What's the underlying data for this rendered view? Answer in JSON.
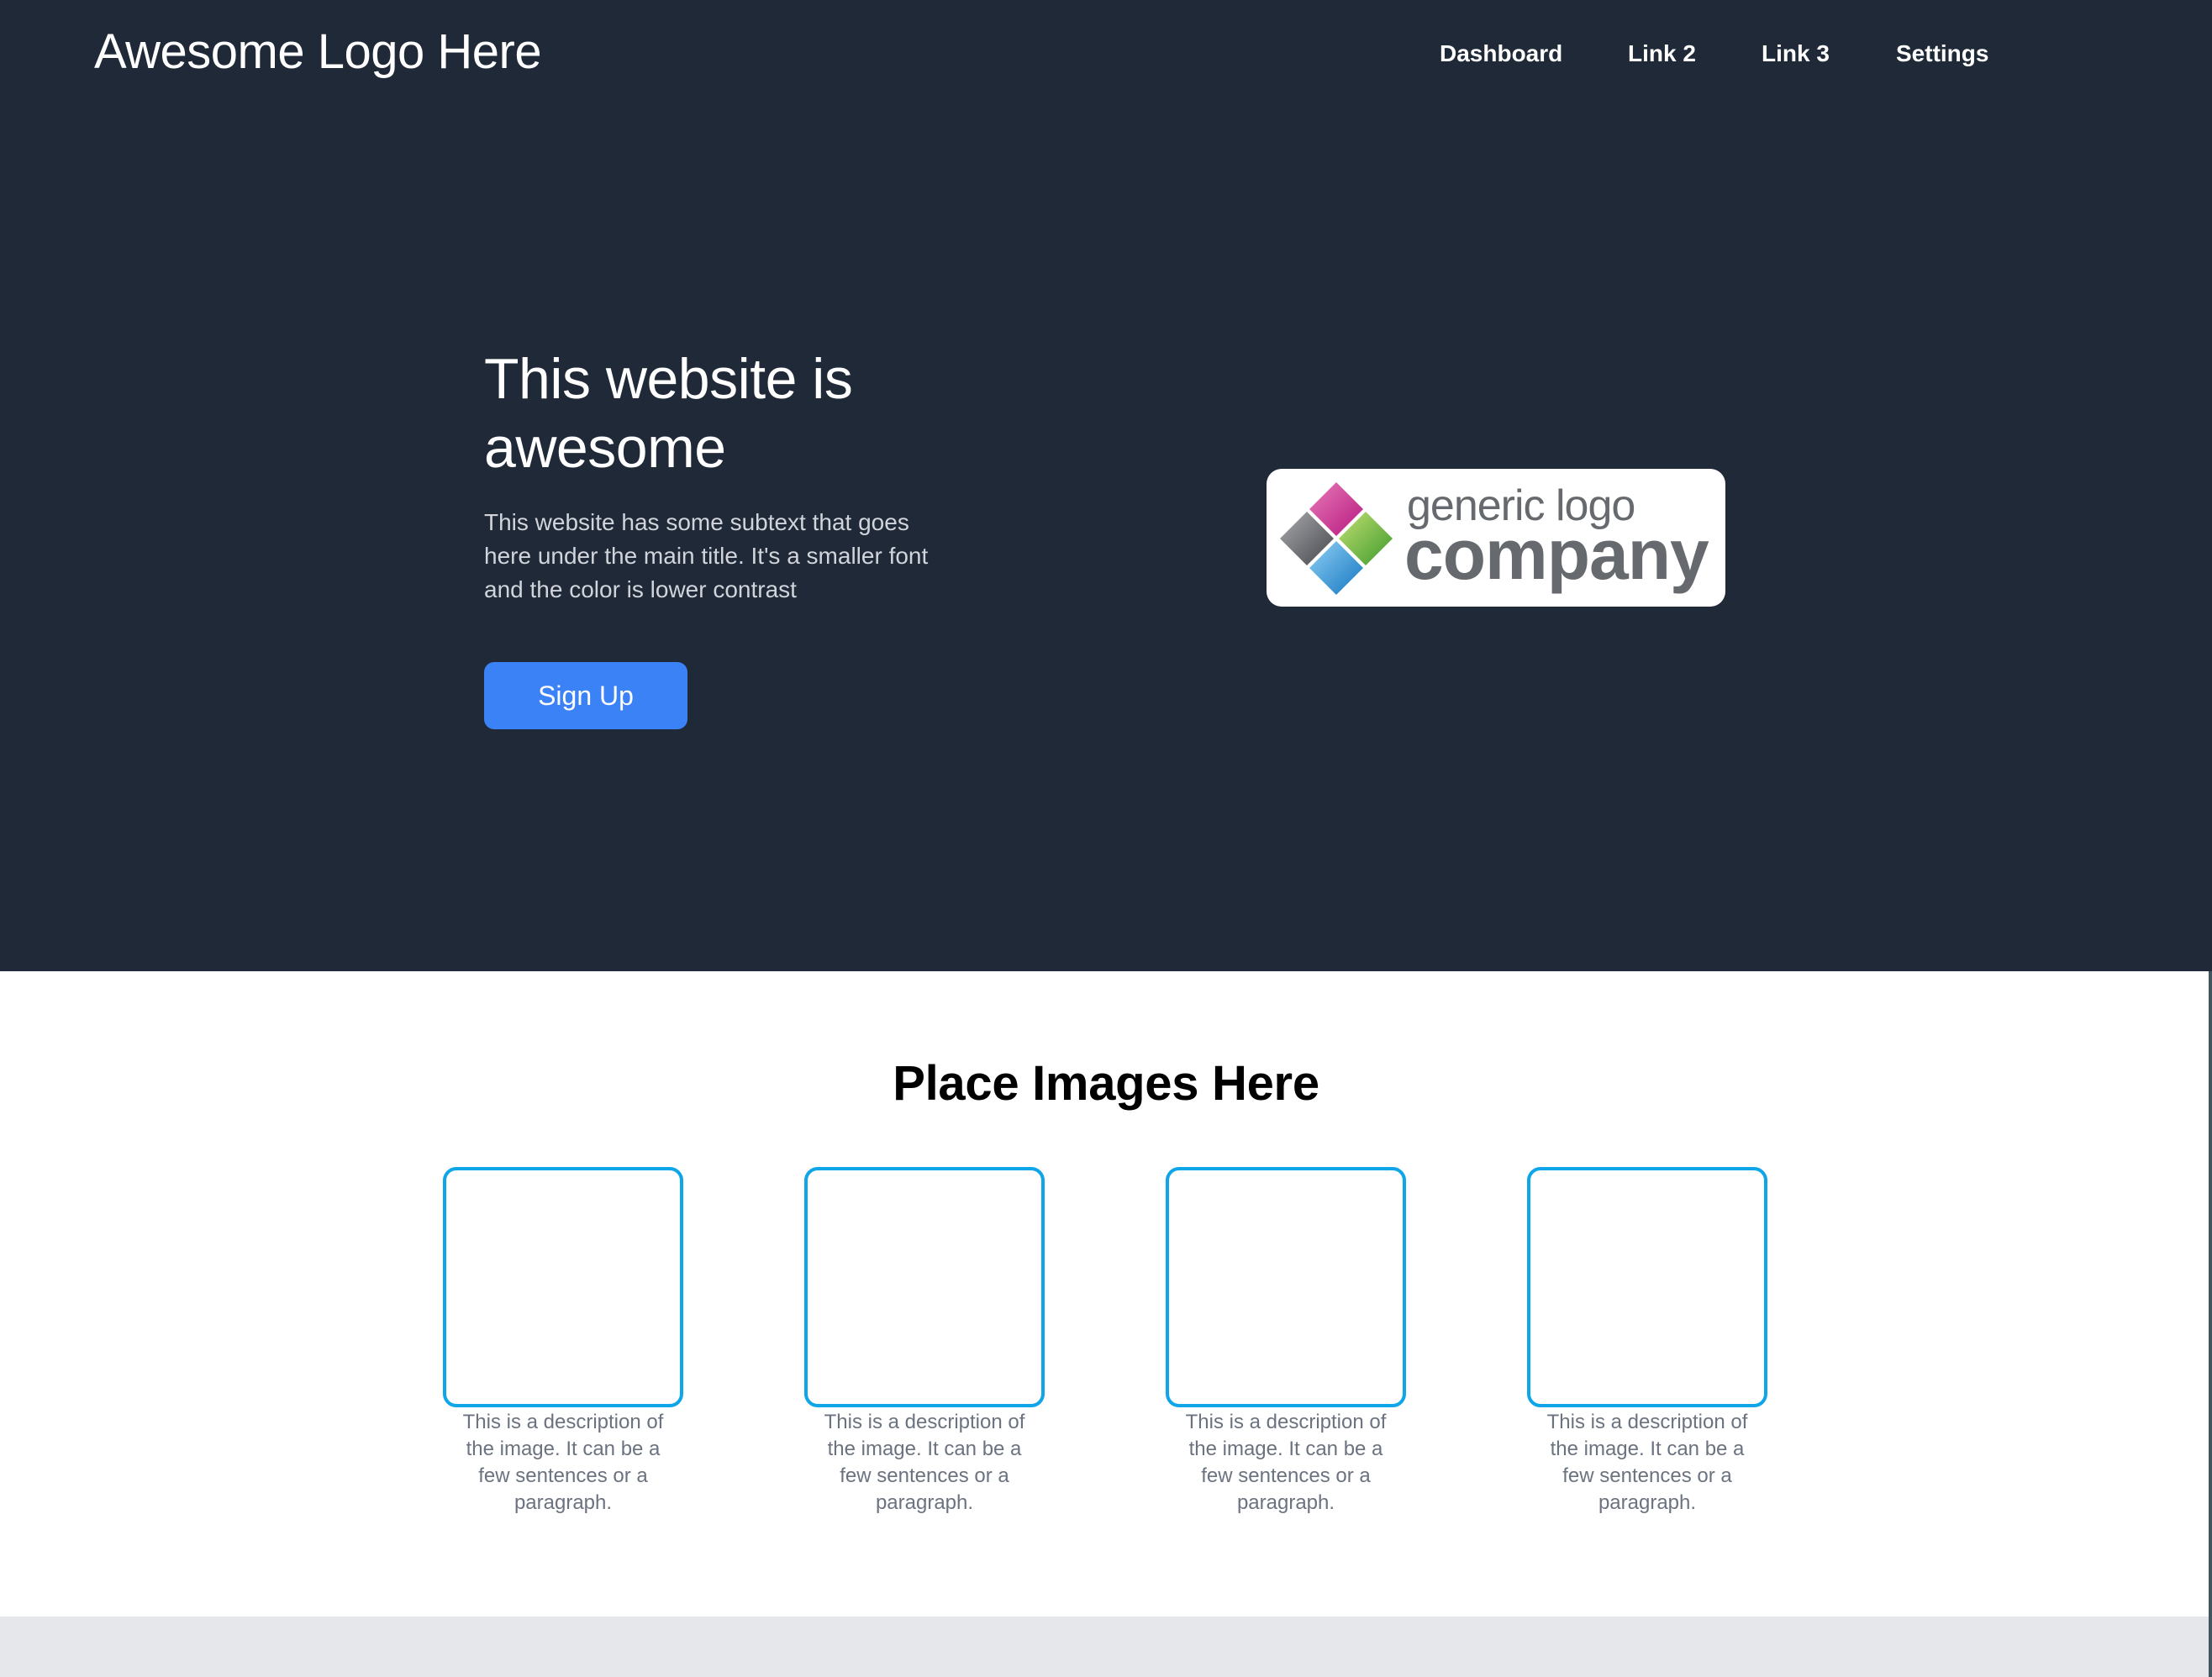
{
  "header": {
    "brand": "Awesome Logo Here",
    "nav": [
      {
        "label": "Dashboard"
      },
      {
        "label": "Link 2"
      },
      {
        "label": "Link 3"
      },
      {
        "label": "Settings"
      }
    ]
  },
  "hero": {
    "title": "This website is awesome",
    "subtitle": "This website has some subtext that goes here under the main title. It's a smaller font and the color is lower contrast",
    "cta_label": "Sign Up",
    "logo": {
      "icon": "four-diamond-logo-icon",
      "line1": "generic logo",
      "line2": "company",
      "colors": {
        "magenta": "#c9268f",
        "gray": "#5f6166",
        "green": "#62b338",
        "blue": "#1f8fd6"
      }
    }
  },
  "gallery": {
    "title": "Place Images Here",
    "items": [
      {
        "caption": "This is a description of the image. It can be a few sentences or a paragraph."
      },
      {
        "caption": "This is a description of the image. It can be a few sentences or a paragraph."
      },
      {
        "caption": "This is a description of the image. It can be a few sentences or a paragraph."
      },
      {
        "caption": "This is a description of the image. It can be a few sentences or a paragraph."
      }
    ]
  },
  "theme": {
    "hero_bg": "#1f2937",
    "accent": "#3b82f6",
    "card_border": "#0ea5e9",
    "caption_color": "#6b7280",
    "footer_bg": "#e5e7eb"
  }
}
